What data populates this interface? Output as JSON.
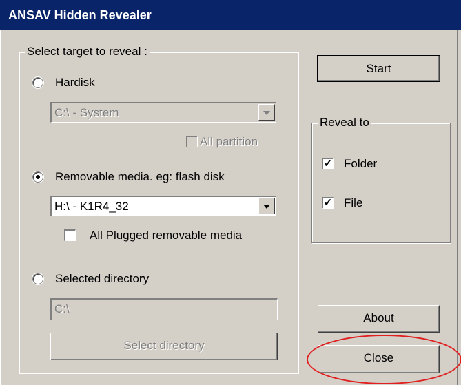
{
  "window": {
    "title": "ANSAV Hidden Revealer"
  },
  "target_group": {
    "legend": "Select target to reveal :",
    "hardisk": {
      "label": "Hardisk",
      "checked": false
    },
    "hardisk_combo": {
      "value": "C:\\ - System",
      "enabled": false
    },
    "all_partition": {
      "label": "All partition",
      "checked": false,
      "enabled": false
    },
    "removable": {
      "label": "Removable media. eg: flash disk",
      "checked": true
    },
    "removable_combo": {
      "value": "H:\\ - K1R4_32",
      "enabled": true
    },
    "all_plugged": {
      "label": "All Plugged removable media",
      "checked": false
    },
    "selected_dir": {
      "label": "Selected directory",
      "checked": false
    },
    "dir_input": {
      "value": "C:\\",
      "enabled": false
    },
    "select_dir_button": {
      "label": "Select directory",
      "enabled": false
    }
  },
  "start_button": {
    "label": "Start"
  },
  "reveal_group": {
    "legend": "Reveal to",
    "folder": {
      "label": "Folder",
      "checked": true
    },
    "file": {
      "label": "File",
      "checked": true
    }
  },
  "about_button": {
    "label": "About"
  },
  "close_button": {
    "label": "Close"
  },
  "annotation": {
    "color": "#e02020",
    "target": "close_button"
  },
  "colors": {
    "titlebar": "#0a246a",
    "face": "#d4d0c8",
    "highlight": "#e02020"
  }
}
